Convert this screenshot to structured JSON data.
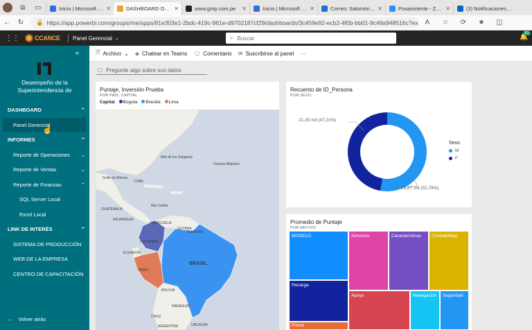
{
  "browser": {
    "tabs": [
      {
        "title": "Inicio | Microsoft 365",
        "icon_color": "#2f6fdf",
        "active": false
      },
      {
        "title": "DASHBOARD OPERA",
        "icon_color": "#e8a52c",
        "active": true
      },
      {
        "title": "www.gmp.com.pe",
        "icon_color": "#222222",
        "active": false
      },
      {
        "title": "Inicio | Microsoft 365",
        "icon_color": "#2f6fdf",
        "active": false
      },
      {
        "title": "Correo: Salomón Ccanc",
        "icon_color": "#1e6fd0",
        "active": false
      },
      {
        "title": "Posasistente - Zoom",
        "icon_color": "#2d8cff",
        "active": false
      },
      {
        "title": "(3) Notificaciones | L",
        "icon_color": "#0a66c2",
        "active": false
      }
    ],
    "url": "https://app.powerbi.com/groups/me/apps/81e303e1-2bdc-419c-961e-d9702187cf29/dashboards/3c459e92-ecb2-4f0b-bb01-9c48a948516c?experien..."
  },
  "app": {
    "logo_text": "CCANCE",
    "report_name": "Panel Gerencial",
    "search_placeholder": "Buscar",
    "notif_count": "31"
  },
  "actions": [
    "Archivo",
    "Chatear en Teams",
    "Comentario",
    "Suscribirse al panel",
    "···"
  ],
  "sidebar": {
    "title": "Desempeño de la Superintendencia de",
    "sections": [
      {
        "label": "DASHBOARD",
        "items": [
          {
            "label": "Panel Gerencial",
            "active": true
          }
        ]
      },
      {
        "label": "INFORMES",
        "items": [
          {
            "label": "Reporte de Operaciones"
          },
          {
            "label": "Reporte de Ventas"
          },
          {
            "label": "Reporte de Finanzas"
          },
          {
            "label": "SQL Server Local",
            "sub": true
          },
          {
            "label": "Excel Local",
            "sub": true
          }
        ]
      },
      {
        "label": "LINK DE INTERÉS",
        "items": [
          {
            "label": "SISTEMA DE PRODUCCIÓN"
          },
          {
            "label": "WEB DE LA EMPRESA"
          },
          {
            "label": "CENTRO DE CAPACITACIÓN"
          }
        ]
      }
    ],
    "back_label": "Volver atrás"
  },
  "qa_placeholder": "Pregunte algo sobre sus datos",
  "map": {
    "title": "Puntaje, Inversión Prueba",
    "subtitle": "POR PAÍS, CAPITAL",
    "legend_title": "Capital",
    "legend": [
      {
        "name": "Bogota",
        "color": "#1f3b8f"
      },
      {
        "name": "Brasilia",
        "color": "#3a93f0"
      },
      {
        "name": "Lima",
        "color": "#e07a58"
      }
    ],
    "labels": {
      "ocean": "Océano Atlántico",
      "brasil": "BRASIL",
      "peru": "PERÚ",
      "venezuela": "VENEZUELA",
      "colombia": "COLOMBIA",
      "bolivia": "BOLIVIA",
      "paraguay": "PARAGUAY",
      "chile": "CHILE",
      "argentina": "ARGENTINA",
      "uruguay": "URUGUAY",
      "ecuador": "ECUADOR",
      "cuba": "CUBA",
      "mexico": "Golfo de México",
      "caribe": "Mar Caribe",
      "sargazos": "Mar de los Sargazos",
      "guatemala": "GUATEMALA",
      "nicaragua": "NICARAGUA",
      "guyana": "GUYANA",
      "surinam": "SURINAM"
    }
  },
  "donut": {
    "title": "Recuento de ID_Persona",
    "subtitle": "POR SEXO",
    "legend_title": "Sexo",
    "label_f": "21,35 mil (47,21%)",
    "label_m": "23,87 mil (52,79%)",
    "chart_data": {
      "type": "pie",
      "categories": [
        "M",
        "F"
      ],
      "values": [
        23870,
        21350
      ],
      "colors": [
        "#2196f3",
        "#12239e"
      ]
    }
  },
  "treemap": {
    "title": "Promedio de Puntaje",
    "subtitle": "POR MOTIVO",
    "tiles": [
      {
        "label": "MODELO",
        "color": "#118dff"
      },
      {
        "label": "Servicios",
        "color": "#e044a7"
      },
      {
        "label": "Caracteristicas",
        "color": "#744ec2"
      },
      {
        "label": "Confiabilidad",
        "color": "#d9b300"
      },
      {
        "label": "Recarga",
        "color": "#12239e"
      },
      {
        "label": "Apoyo",
        "color": "#d64550"
      },
      {
        "label": "Navegación",
        "color": "#1aab40"
      },
      {
        "label": "Seguridad",
        "color": "#15c6f4"
      },
      {
        "label": "Precio",
        "color": "#e66c37"
      }
    ]
  }
}
